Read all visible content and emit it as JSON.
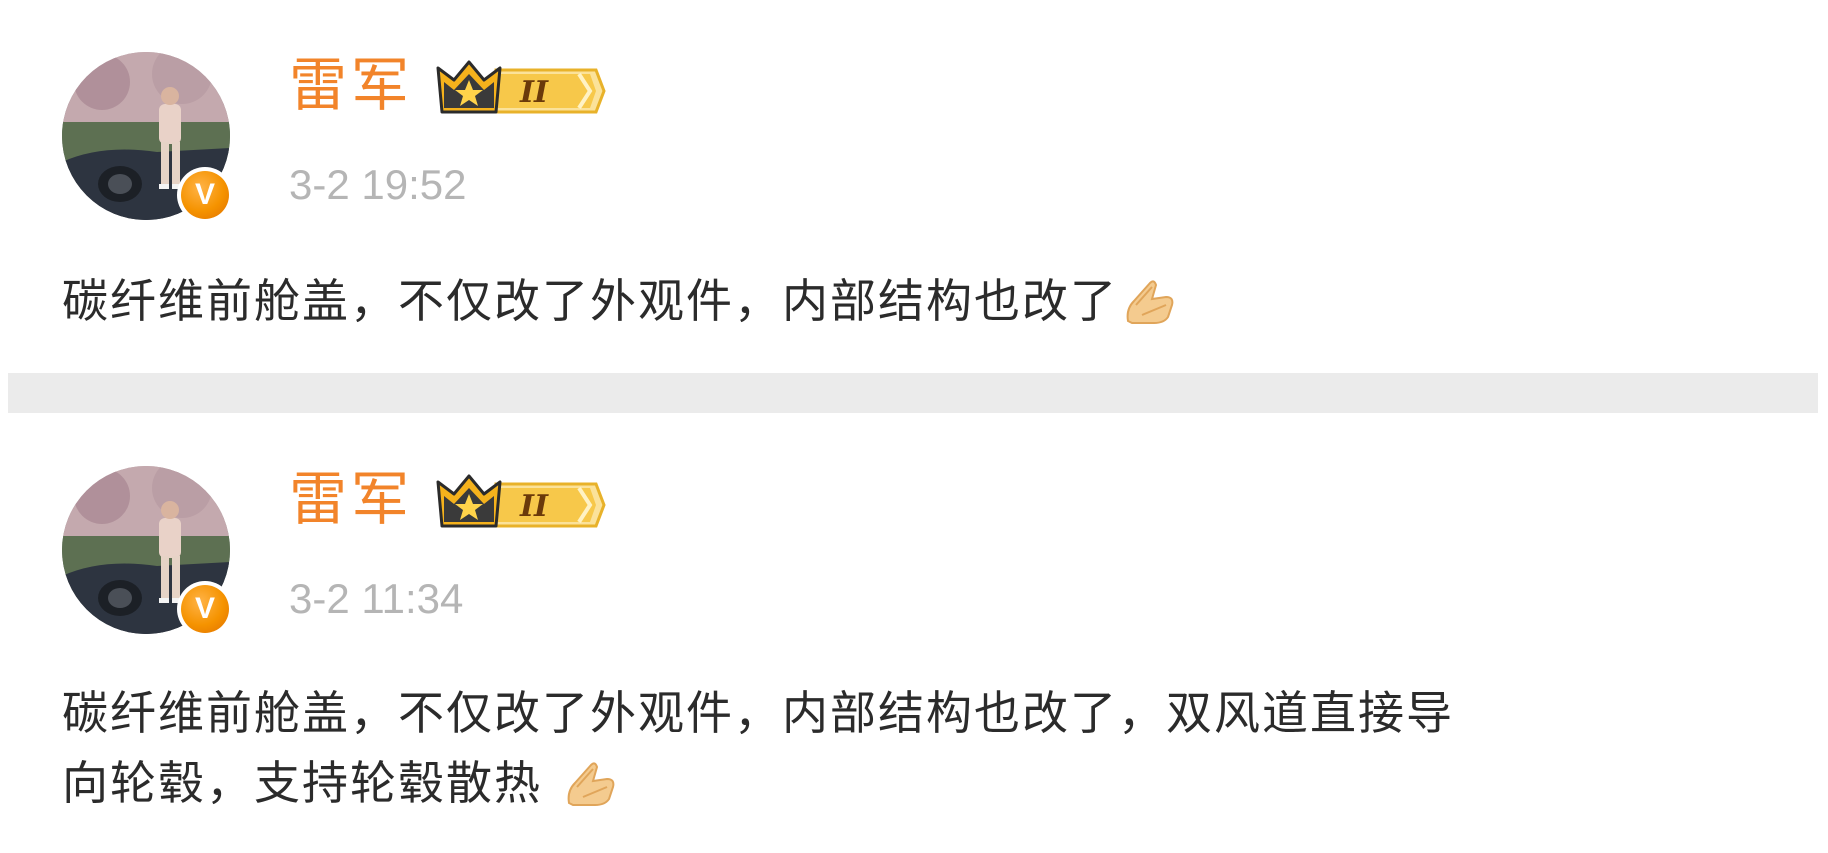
{
  "posts": [
    {
      "author": "雷军",
      "verified_mark": "V",
      "vip_level": "II",
      "timestamp": "3-2 19:52",
      "text": "碳纤维前舱盖，不仅改了外观件，内部结构也改了",
      "emoji": "folded-hands-icon"
    },
    {
      "author": "雷军",
      "verified_mark": "V",
      "vip_level": "II",
      "timestamp": "3-2 11:34",
      "text_line1": "碳纤维前舱盖，不仅改了外观件，内部结构也改了，双风道直接导",
      "text_line2": "向轮毂，支持轮毂散热",
      "emoji": "folded-hands-icon"
    }
  ],
  "colors": {
    "username": "#f2842a",
    "timestamp": "#b5b5b5",
    "text": "#2b2b2b",
    "divider": "#ebebeb",
    "vip_gold": "#f7c233"
  }
}
